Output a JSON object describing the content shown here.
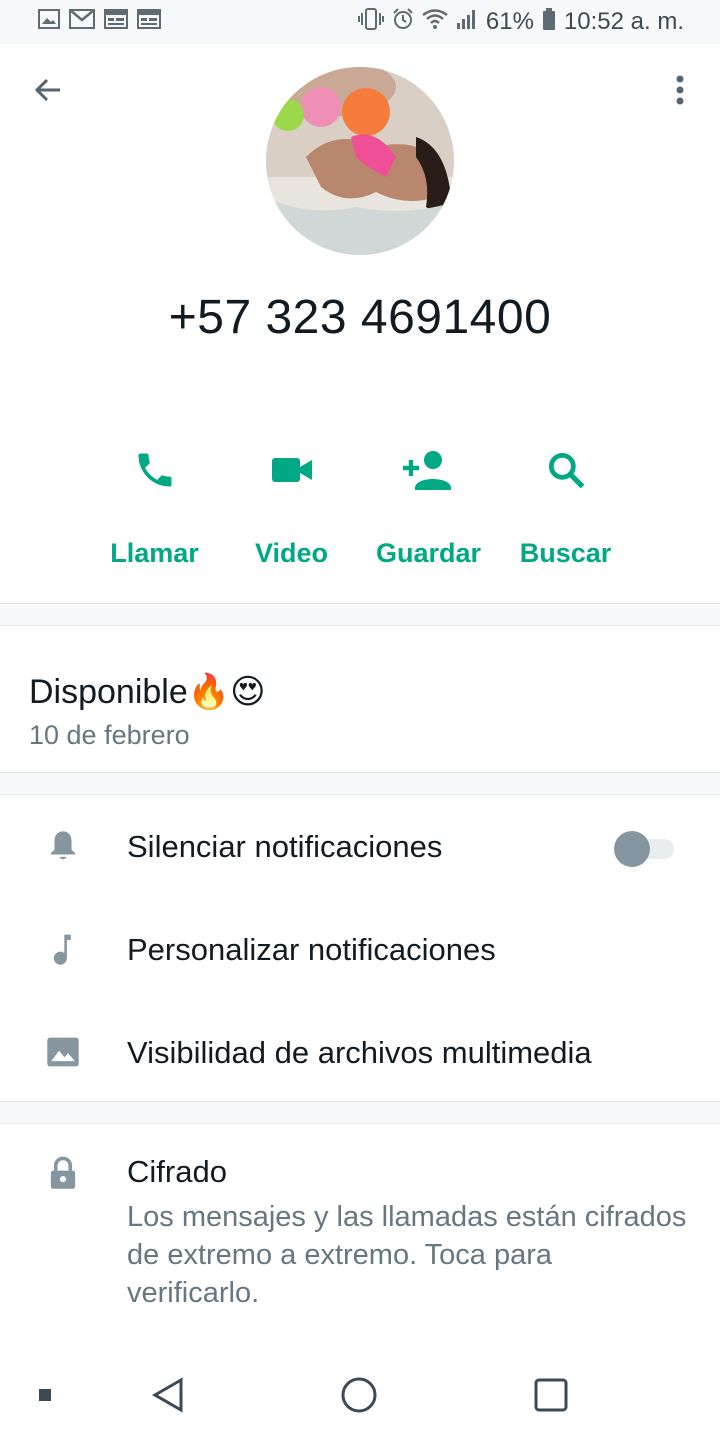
{
  "status_bar": {
    "battery_percent": "61%",
    "time": "10:52 a. m.",
    "left_icons": [
      "image-notification-icon",
      "gmail-icon",
      "calendar-icon",
      "calendar-icon"
    ],
    "right_icons": [
      "vibrate-icon",
      "alarm-icon",
      "wifi-icon",
      "signal-icon",
      "battery-icon"
    ]
  },
  "header": {
    "back_icon": "arrow-back-icon",
    "menu_icon": "more-vert-icon",
    "phone_number": "+57 323 4691400"
  },
  "actions": [
    {
      "label": "Llamar",
      "icon": "phone-icon"
    },
    {
      "label": "Video",
      "icon": "videocam-icon"
    },
    {
      "label": "Guardar",
      "icon": "person-add-icon"
    },
    {
      "label": "Buscar",
      "icon": "search-icon"
    }
  ],
  "about": {
    "status": "Disponible🔥😍",
    "date": "10 de febrero"
  },
  "settings": [
    {
      "label": "Silenciar notificaciones",
      "icon": "bell-icon",
      "toggle_on": false
    },
    {
      "label": "Personalizar notificaciones",
      "icon": "music-note-icon"
    },
    {
      "label": "Visibilidad de archivos multimedia",
      "icon": "image-icon"
    }
  ],
  "encryption": {
    "title": "Cifrado",
    "description": "Los mensajes y las llamadas están cifrados de extremo a extremo. Toca para verificarlo.",
    "icon": "lock-icon"
  },
  "colors": {
    "accent": "#00a884",
    "icon_gray": "#8696a0",
    "secondary_text": "#667781"
  }
}
